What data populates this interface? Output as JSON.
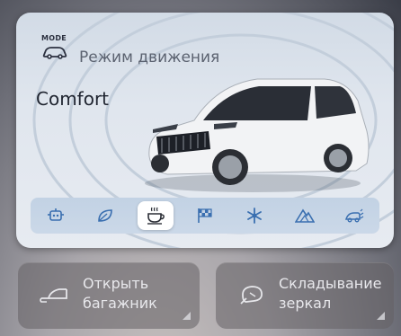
{
  "drive_mode": {
    "badge_text": "MODE",
    "title": "Режим движения",
    "current_mode": "Comfort",
    "modes": [
      {
        "icon": "robot-icon",
        "active": false
      },
      {
        "icon": "leaf-icon",
        "active": false
      },
      {
        "icon": "coffee-cup-icon",
        "active": true
      },
      {
        "icon": "checkered-flag-icon",
        "active": false
      },
      {
        "icon": "snowflake-icon",
        "active": false
      },
      {
        "icon": "mountain-icon",
        "active": false
      },
      {
        "icon": "off-road-slope-icon",
        "active": false
      }
    ],
    "accent_color": "#3a6fb0"
  },
  "actions": {
    "trunk": {
      "line1": "Открыть",
      "line2": "багажник",
      "icon": "trunk-open-icon"
    },
    "mirrors": {
      "line1": "Складывание",
      "line2": "зеркал",
      "icon": "mirror-fold-icon"
    }
  }
}
